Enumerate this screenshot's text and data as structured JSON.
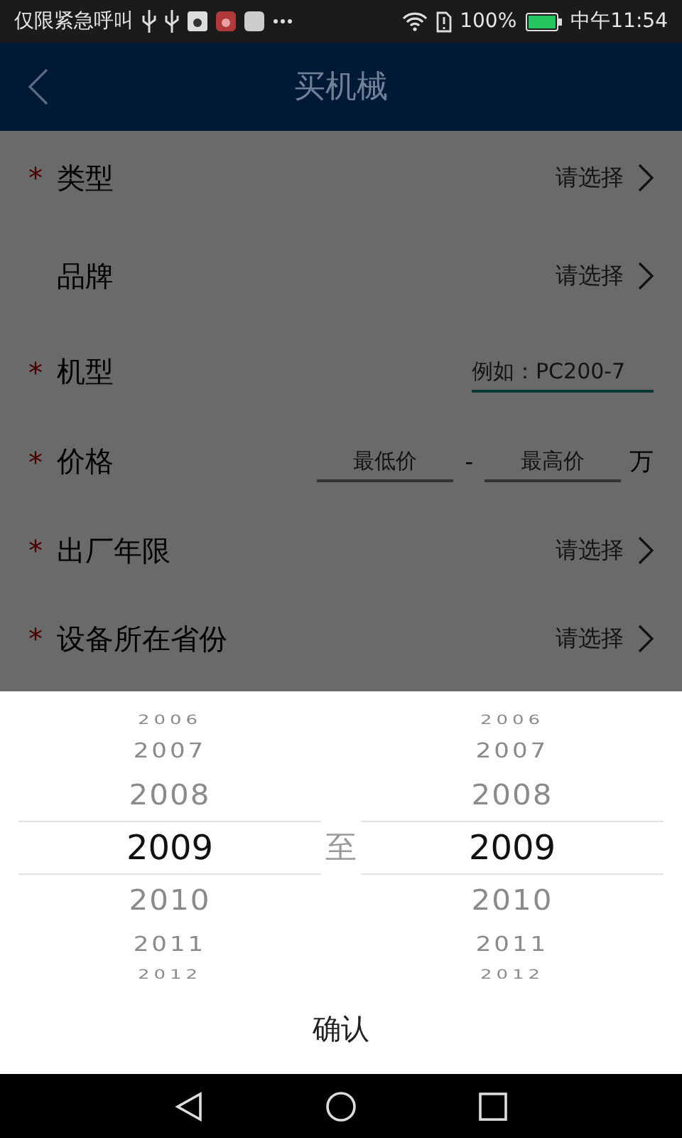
{
  "status_bar": {
    "carrier": "仅限紧急呼叫",
    "battery": "100%",
    "time": "中午11:54"
  },
  "header": {
    "title": "买机械"
  },
  "form": [
    {
      "kind": "select",
      "label": "类型",
      "required_mark": "*",
      "placeholder": "请选择"
    },
    {
      "kind": "select",
      "label": "品牌",
      "placeholder": "请选择"
    },
    {
      "kind": "input",
      "label": "机型",
      "required_mark": "*",
      "placeholder": "例如：PC200-7"
    },
    {
      "kind": "range",
      "label": "价格",
      "required_mark": "*",
      "min_placeholder": "最低价",
      "separator": "-",
      "max_placeholder": "最高价",
      "unit": "万"
    },
    {
      "kind": "select",
      "label": "出厂年限",
      "required_mark": "*",
      "placeholder": "请选择"
    },
    {
      "kind": "select",
      "label": "设备所在省份",
      "required_mark": "*",
      "placeholder": "请选择"
    }
  ],
  "year_picker": {
    "from": [
      {
        "label": "2006",
        "selected": false
      },
      {
        "label": "2007",
        "selected": false
      },
      {
        "label": "2008",
        "selected": false
      },
      {
        "label": "2009",
        "selected": true
      },
      {
        "label": "2010",
        "selected": false
      },
      {
        "label": "2011",
        "selected": false
      },
      {
        "label": "2012",
        "selected": false
      }
    ],
    "separator": "至",
    "to": [
      {
        "label": "2006",
        "selected": false
      },
      {
        "label": "2007",
        "selected": false
      },
      {
        "label": "2008",
        "selected": false
      },
      {
        "label": "2009",
        "selected": true
      },
      {
        "label": "2010",
        "selected": false
      },
      {
        "label": "2011",
        "selected": false
      },
      {
        "label": "2012",
        "selected": false
      }
    ],
    "confirm": "确认"
  }
}
